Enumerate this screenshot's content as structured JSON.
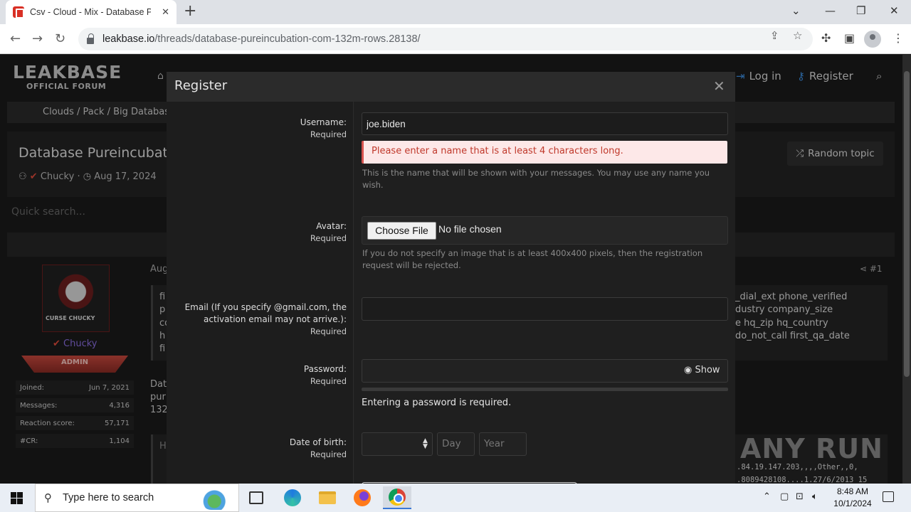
{
  "browser": {
    "tab_title": "Csv - Cloud - Mix - Database Pu",
    "tab_close": "✕",
    "new_tab": "+",
    "url_host": "leakbase.io",
    "url_path": "/threads/database-pureincubation-com-132m-rows.28138/",
    "window_controls": [
      "⌄",
      "—",
      "❐",
      "✕"
    ]
  },
  "site": {
    "logo_main": "LEAKBASE",
    "logo_sub": "OFFICIAL FORUM",
    "nav_login": "Log in",
    "nav_register": "Register",
    "breadcrumb": "Clouds / Pack / Big Databases",
    "thread_title": "Database Pureincubat",
    "thread_author": "Chucky",
    "thread_date": "Aug 17, 2024",
    "random_topic": "Random topic",
    "quick_search": "Quick search...",
    "post_date_partial": "Aug",
    "post_number": "#1",
    "user": {
      "name": "Chucky",
      "avatar_text": "CURSE CHUCKY",
      "badge": "ADMIN",
      "stats": [
        {
          "label": "Joined:",
          "value": "Jun 7, 2021"
        },
        {
          "label": "Messages:",
          "value": "4,316"
        },
        {
          "label": "Reaction score:",
          "value": "57,171"
        },
        {
          "label": "#CR:",
          "value": "1,104"
        }
      ]
    },
    "quote_left": [
      "fi",
      "p",
      "co",
      "h",
      "fi"
    ],
    "quote_right": [
      "_dial_ext phone_verified",
      "dustry company_size",
      "e hq_zip hq_country",
      "do_not_call first_qa_date"
    ],
    "body_left": [
      "Dat",
      "pur",
      "132"
    ],
    "code_left": "H",
    "code_right": [
      ".84.19.147.203,,,,Other,,0,",
      ".8089428108....1.27/6/2013 15"
    ],
    "watermark": "ANY RUN"
  },
  "modal": {
    "title": "Register",
    "close": "✕",
    "required": "Required",
    "username": {
      "label": "Username:",
      "value": "joe.biden",
      "error": "Please enter a name that is at least 4 characters long.",
      "hint": "This is the name that will be shown with your messages. You may use any name you wish."
    },
    "avatar": {
      "label": "Avatar:",
      "button": "Choose File",
      "status": "No file chosen",
      "hint": "If you do not specify an image that is at least 400x400 pixels, then the registration request will be rejected."
    },
    "email": {
      "label": "Email (If you specify @gmail.com, the activation email may not arrive.):",
      "value": ""
    },
    "password": {
      "label": "Password:",
      "show": "Show",
      "message": "Entering a password is required."
    },
    "dob": {
      "label": "Date of birth:",
      "month_value": "",
      "day_placeholder": "Day",
      "year_placeholder": "Year"
    }
  },
  "taskbar": {
    "search_placeholder": "Type here to search",
    "time": "8:48 AM",
    "date": "10/1/2024"
  }
}
